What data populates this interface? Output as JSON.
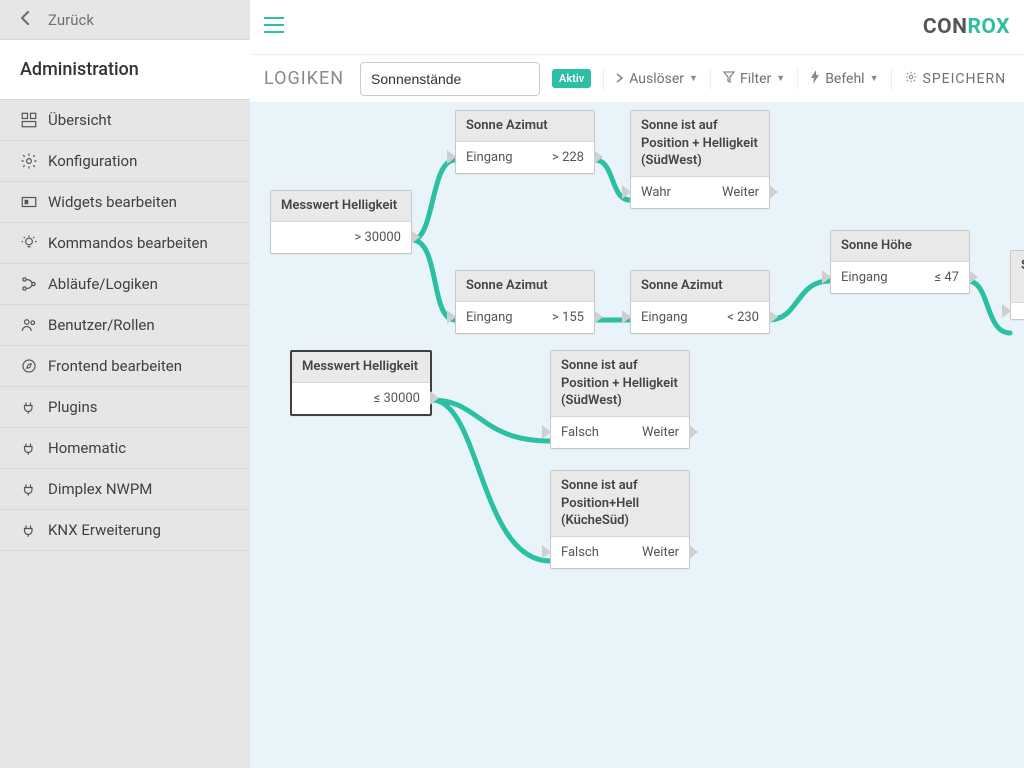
{
  "sidebar": {
    "back": "Zurück",
    "title": "Administration",
    "items": [
      {
        "icon": "dashboard",
        "label": "Übersicht"
      },
      {
        "icon": "gear",
        "label": "Konfiguration"
      },
      {
        "icon": "widgets",
        "label": "Widgets bearbeiten"
      },
      {
        "icon": "bulb",
        "label": "Kommandos bearbeiten"
      },
      {
        "icon": "flow",
        "label": "Abläufe/Logiken"
      },
      {
        "icon": "users",
        "label": "Benutzer/Rollen"
      },
      {
        "icon": "compass",
        "label": "Frontend bearbeiten"
      },
      {
        "icon": "plug",
        "label": "Plugins"
      },
      {
        "icon": "plug",
        "label": "Homematic"
      },
      {
        "icon": "plug",
        "label": "Dimplex NWPM"
      },
      {
        "icon": "plug",
        "label": "KNX Erweiterung"
      }
    ]
  },
  "brand": {
    "prefix": "CON",
    "suffix": "ROX"
  },
  "toolbar": {
    "title": "LOGIKEN",
    "input_value": "Sonnenstände",
    "badge": "Aktiv",
    "trigger": "Auslöser",
    "filter": "Filter",
    "command": "Befehl",
    "save": "SPEICHERN"
  },
  "nodes": {
    "n1": {
      "title": "Messwert Helligkeit",
      "row_right": "> 30000"
    },
    "n2": {
      "title": "Sonne Azimut",
      "row_left": "Eingang",
      "row_right": "> 228"
    },
    "n3": {
      "title": "Sonne ist auf Position + Helligkeit (SüdWest)",
      "row_left": "Wahr",
      "row_right": "Weiter"
    },
    "n4": {
      "title": "Sonne Azimut",
      "row_left": "Eingang",
      "row_right": "> 155"
    },
    "n5": {
      "title": "Sonne Azimut",
      "row_left": "Eingang",
      "row_right": "< 230"
    },
    "n6": {
      "title": "Sonne Höhe",
      "row_left": "Eingang",
      "row_right": "≤ 47"
    },
    "n7": {
      "title": "Messwert Helligkeit",
      "row_right": "≤ 30000"
    },
    "n8": {
      "title": "Sonne ist auf Position + Helligkeit (SüdWest)",
      "row_left": "Falsch",
      "row_right": "Weiter"
    },
    "n9": {
      "title": "Sonne ist auf Position+Hell (KücheSüd)",
      "row_left": "Falsch",
      "row_right": "Weiter"
    },
    "n10": {
      "title": "S"
    }
  }
}
